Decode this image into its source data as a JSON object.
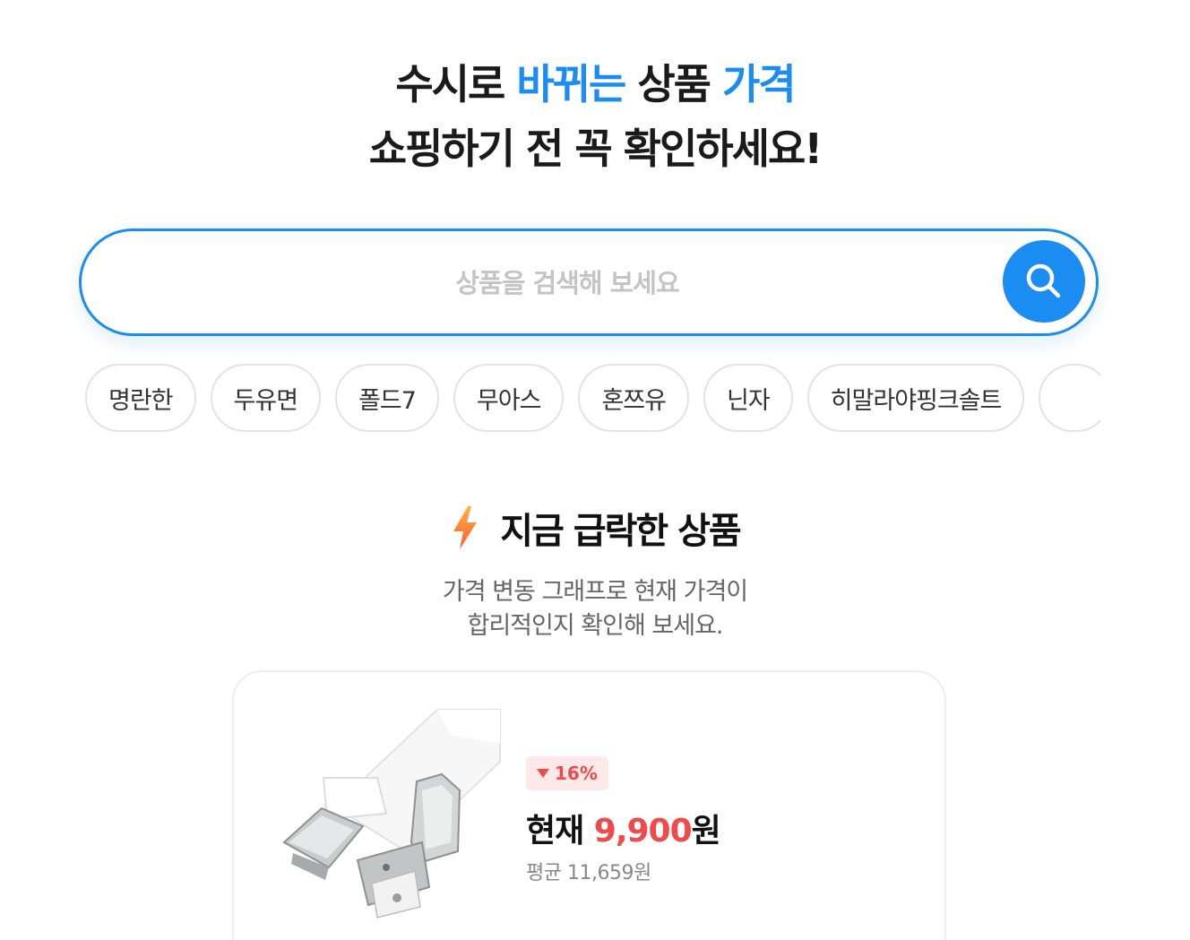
{
  "hero": {
    "line1_part1": "수시로 ",
    "line1_accent1": "바뀌는",
    "line1_part2": " 상품 ",
    "line1_accent2": "가격",
    "line2": "쇼핑하기 전 꼭 확인하세요!"
  },
  "search": {
    "placeholder": "상품을 검색해 보세요",
    "value": "",
    "button_icon": "search-icon"
  },
  "keywords": [
    "명란한",
    "두유면",
    "폴드7",
    "무아스",
    "혼쯔유",
    "닌자",
    "히말라야핑크솔트",
    ""
  ],
  "section": {
    "icon": "lightning-icon",
    "title": "지금 급락한 상품",
    "desc_line1": "가격 변동 그래프로 현재 가격이",
    "desc_line2": "합리적인지 확인해 보세요."
  },
  "product": {
    "image_icon": "suspender-clip-image",
    "discount_badge": "16%",
    "current_label": "현재 ",
    "current_price": "9,900",
    "current_unit": "원",
    "average_text": "평균 11,659원"
  },
  "colors": {
    "accent_blue": "#1a8cf2",
    "price_red": "#f04a4a",
    "badge_bg": "#ffe8e8",
    "lightning_orange": "#ff7a2e"
  }
}
